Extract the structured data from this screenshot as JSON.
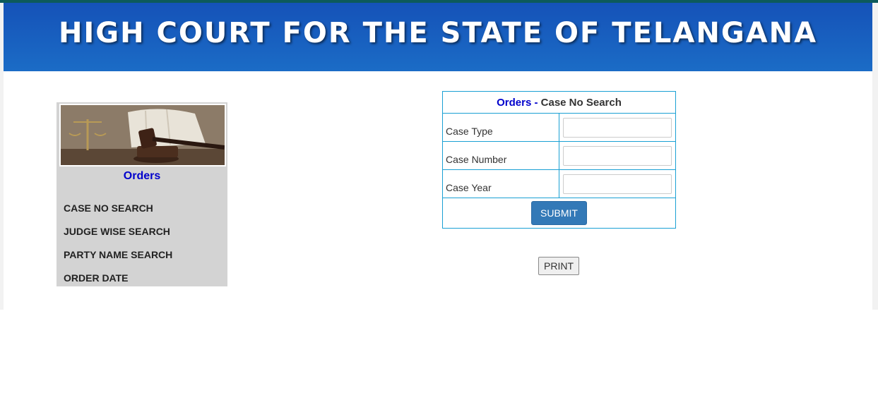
{
  "banner": {
    "title": "HIGH COURT FOR THE STATE OF TELANGANA"
  },
  "sidebar": {
    "image_icon": "gavel-scales-icon",
    "title": "Orders",
    "links": [
      "CASE NO SEARCH",
      "JUDGE WISE SEARCH",
      "PARTY NAME SEARCH",
      "ORDER DATE"
    ]
  },
  "form": {
    "header_blue": "Orders",
    "header_sep": " - ",
    "header_dark": "Case No Search",
    "fields": [
      {
        "label": "Case Type",
        "value": ""
      },
      {
        "label": "Case Number",
        "value": ""
      },
      {
        "label": "Case Year",
        "value": ""
      }
    ],
    "submit_label": "SUBMIT"
  },
  "print_label": "PRINT",
  "colors": {
    "banner": "#1b6cc6",
    "border": "#1aa0d4",
    "link_blue": "#0000cc",
    "button": "#3379b7",
    "sidebar_bg": "#d3d3d3"
  }
}
